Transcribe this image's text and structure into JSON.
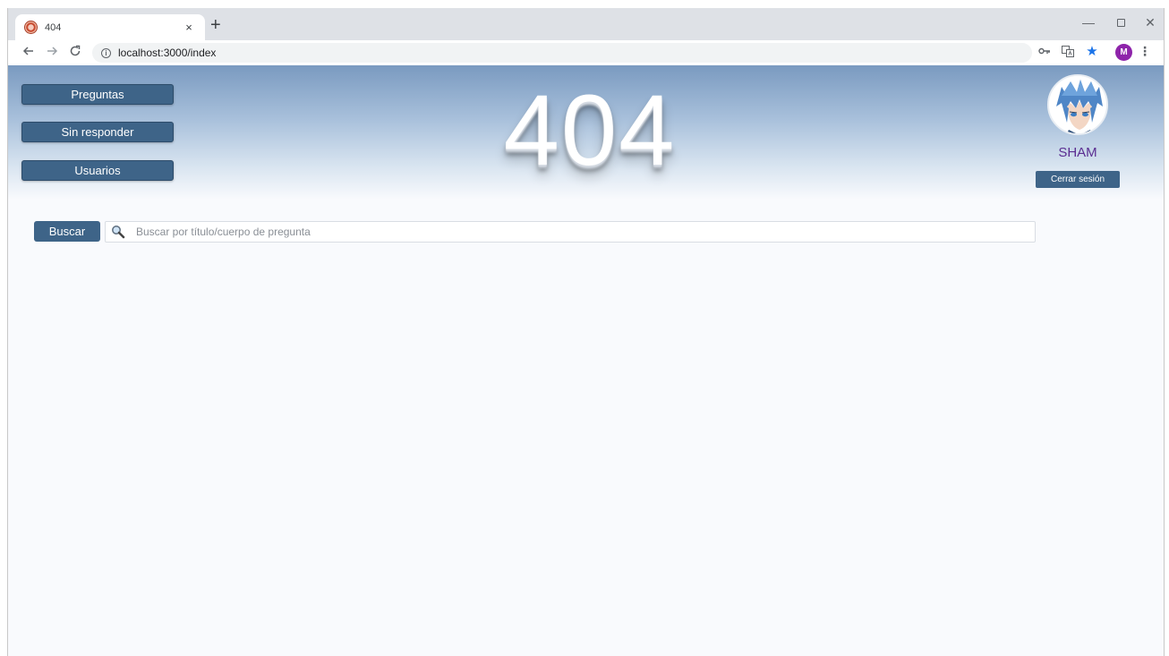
{
  "browser": {
    "tab_title": "404",
    "tab_close": "×",
    "new_tab": "+",
    "url": "localhost:3000/index",
    "profile_initial": "M",
    "window_controls": {
      "minimize": "—",
      "close": "✕"
    }
  },
  "nav": {
    "items": [
      {
        "label": "Preguntas"
      },
      {
        "label": "Sin responder"
      },
      {
        "label": "Usuarios"
      }
    ]
  },
  "hero": {
    "title": "404"
  },
  "user": {
    "name": "SHAM",
    "logout_label": "Cerrar sesión"
  },
  "search": {
    "button_label": "Buscar",
    "placeholder": "Buscar por título/cuerpo de pregunta"
  },
  "colors": {
    "primary": "#3e6488",
    "username": "#5a2d91",
    "background": "#f9fafd"
  }
}
